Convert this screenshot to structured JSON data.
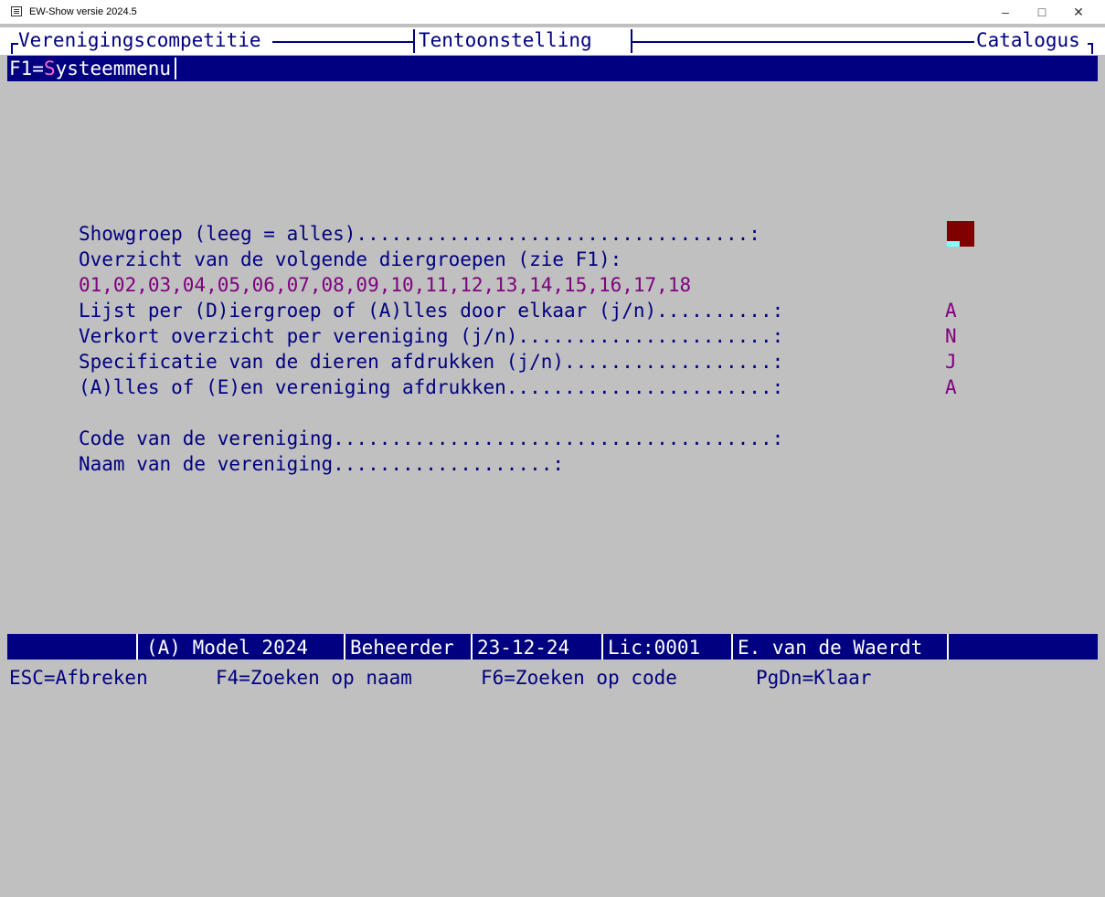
{
  "window": {
    "title": "EW-Show versie 2024.5",
    "controls": [
      "–",
      "□",
      "✕"
    ]
  },
  "menubar": {
    "items": [
      "Verenigingscompetitie",
      "Tentoonstelling",
      "Catalogus"
    ]
  },
  "fkeybar": {
    "prefix": "F1=",
    "hotkey": "S",
    "rest": "ysteemmenu"
  },
  "form": {
    "showgroep_label": "Showgroep (leeg = alles)..................................:",
    "overzicht_label": "Overzicht van de volgende diergroepen (zie F1):",
    "diergroepen": "01,02,03,04,05,06,07,08,09,10,11,12,13,14,15,16,17,18",
    "lijst_label": "Lijst per (D)iergroep of (A)lles door elkaar (j/n)..........:",
    "lijst_value": "A",
    "verkort_label": "Verkort overzicht per vereniging (j/n)......................:",
    "verkort_value": "N",
    "specificatie_label": "Specificatie van de dieren afdrukken (j/n)..................:",
    "specificatie_value": "J",
    "alles_label": "(A)lles of (E)en vereniging afdrukken.......................:",
    "alles_value": "A",
    "code_label": "Code van de vereniging......................................:",
    "naam_label": "Naam van de vereniging...................:"
  },
  "status": {
    "model": "(A) Model 2024",
    "role": "Beheerder",
    "date": "23-12-24",
    "license": "Lic:0001",
    "user": "E. van de Waerdt"
  },
  "hints": {
    "esc": "ESC=Afbreken",
    "f4": "F4=Zoeken op naam",
    "f6": "F6=Zoeken op code",
    "pgdn": "PgDn=Klaar"
  },
  "colors": {
    "background": "#c0c0c0",
    "text": "#000080",
    "value": "#800080",
    "bar": "#000080",
    "cursor": "#800000"
  }
}
